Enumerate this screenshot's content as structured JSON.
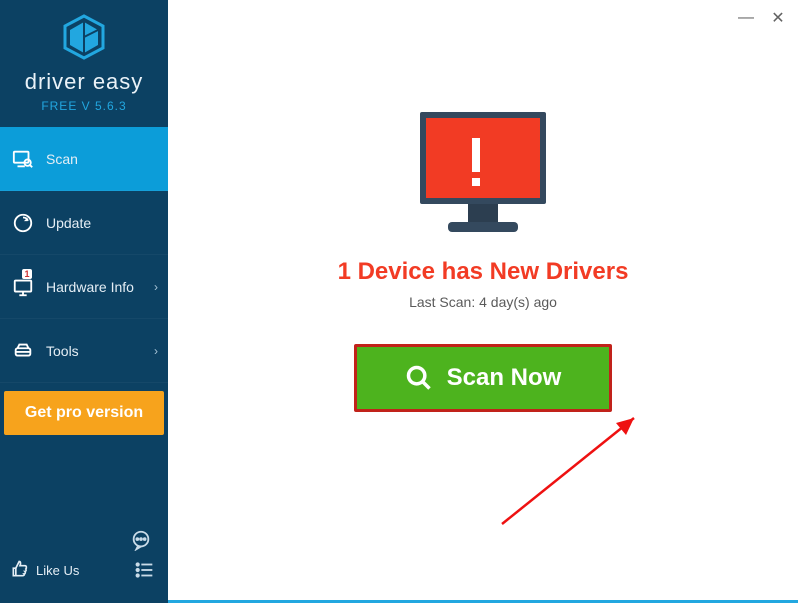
{
  "brand": "driver easy",
  "version": "FREE V 5.6.3",
  "nav": {
    "scan": "Scan",
    "update": "Update",
    "hardware": "Hardware Info",
    "tools": "Tools",
    "update_badge": "1"
  },
  "pro_button": "Get pro version",
  "like_us": "Like Us",
  "headline": "1 Device has New Drivers",
  "last_scan": "Last Scan: 4 day(s) ago",
  "scan_button": "Scan Now",
  "win": {
    "min": "—",
    "close": "✕"
  }
}
